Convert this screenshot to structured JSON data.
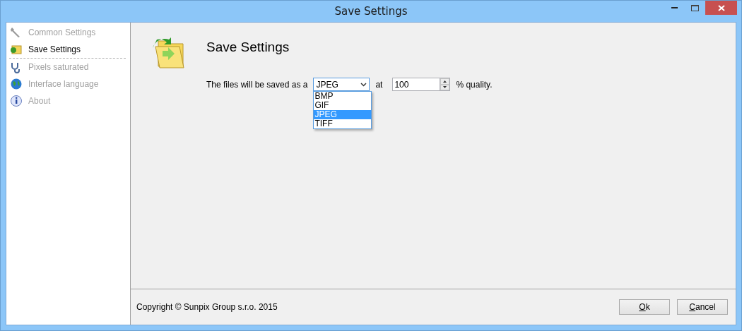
{
  "window": {
    "title": "Save Settings"
  },
  "sidebar": {
    "items": [
      {
        "label": "Common Settings",
        "selected": false
      },
      {
        "label": "Save Settings",
        "selected": true
      },
      {
        "label": "Pixels saturated",
        "selected": false
      },
      {
        "label": "Interface language",
        "selected": false
      },
      {
        "label": "About",
        "selected": false
      }
    ]
  },
  "page": {
    "heading": "Save Settings",
    "format_label": "The files will be saved as a",
    "format": {
      "value": "JPEG",
      "expanded": true,
      "options": [
        {
          "label": "BMP",
          "selected": false
        },
        {
          "label": "GIF",
          "selected": false
        },
        {
          "label": "JPEG",
          "selected": true
        },
        {
          "label": "TIFF",
          "selected": false
        }
      ]
    },
    "at_label": "at",
    "quality": {
      "value": "100"
    },
    "quality_label": "% quality."
  },
  "footer": {
    "copyright": "Copyright © Sunpix Group s.r.o. 2015",
    "buttons": [
      "Ok",
      "Cancel"
    ]
  }
}
